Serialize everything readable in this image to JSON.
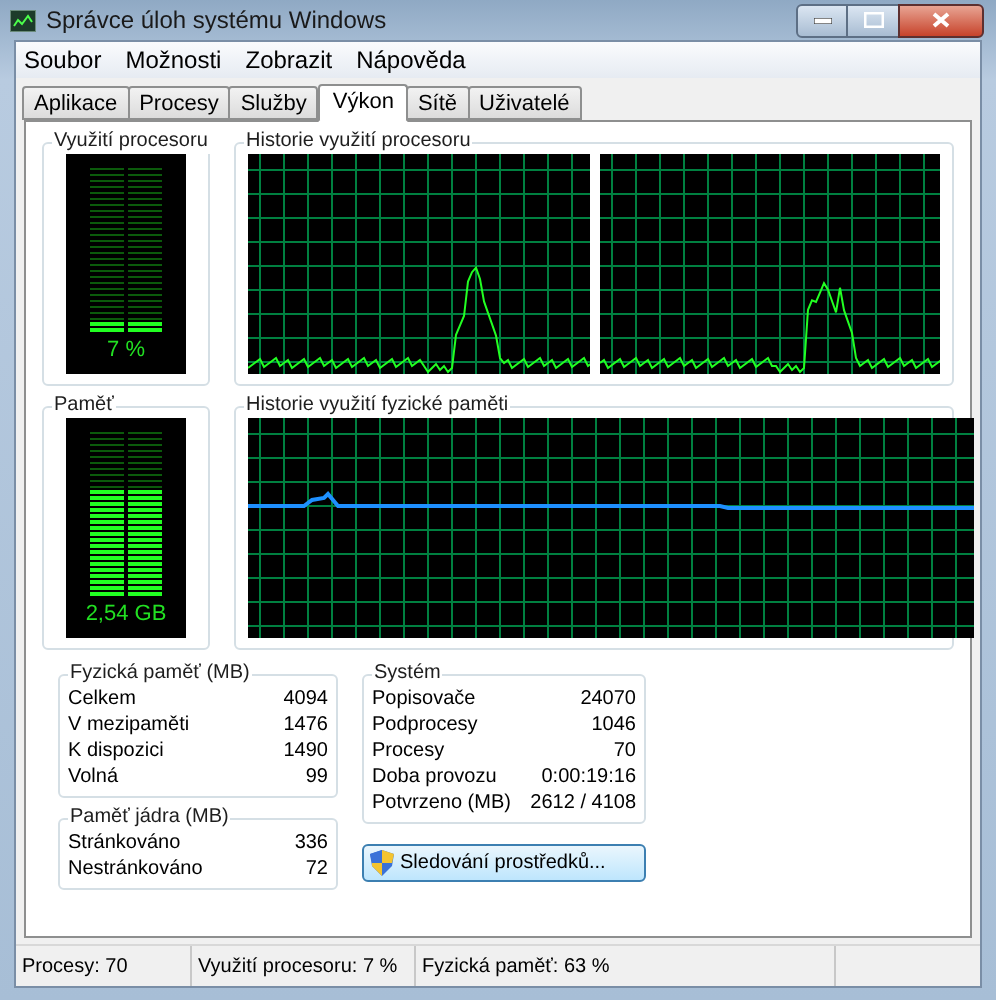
{
  "window": {
    "title": "Správce úloh systému Windows"
  },
  "menu": [
    "Soubor",
    "Možnosti",
    "Zobrazit",
    "Nápověda"
  ],
  "tabs": [
    {
      "label": "Aplikace",
      "selected": false
    },
    {
      "label": "Procesy",
      "selected": false
    },
    {
      "label": "Služby",
      "selected": false
    },
    {
      "label": "Výkon",
      "selected": true
    },
    {
      "label": "Sítě",
      "selected": false
    },
    {
      "label": "Uživatelé",
      "selected": false
    }
  ],
  "cpu_usage": {
    "title": "Využití procesoru",
    "reading": "7 %",
    "level": 0.07
  },
  "cpu_history": {
    "title": "Historie využití procesoru"
  },
  "memory": {
    "title": "Paměť",
    "reading": "2,54 GB",
    "level": 0.63
  },
  "memory_history": {
    "title": "Historie využití fyzické paměti"
  },
  "physical_memory": {
    "title": "Fyzická paměť (MB)",
    "rows": [
      {
        "label": "Celkem",
        "value": "4094"
      },
      {
        "label": "V mezipaměti",
        "value": "1476"
      },
      {
        "label": "K dispozici",
        "value": "1490"
      },
      {
        "label": "Volná",
        "value": "99"
      }
    ]
  },
  "kernel_memory": {
    "title": "Paměť jádra (MB)",
    "rows": [
      {
        "label": "Stránkováno",
        "value": "336"
      },
      {
        "label": "Nestránkováno",
        "value": "72"
      }
    ]
  },
  "system": {
    "title": "Systém",
    "rows": [
      {
        "label": "Popisovače",
        "value": "24070"
      },
      {
        "label": "Podprocesy",
        "value": "1046"
      },
      {
        "label": "Procesy",
        "value": "70"
      },
      {
        "label": "Doba provozu",
        "value": "0:00:19:16"
      },
      {
        "label": "Potvrzeno (MB)",
        "value": "2612 / 4108"
      }
    ]
  },
  "resource_monitor_button": "Sledování prostředků...",
  "status_bar": [
    "Procesy: 70",
    "Využití procesoru: 7 %",
    "Fyzická paměť: 63 %"
  ]
}
